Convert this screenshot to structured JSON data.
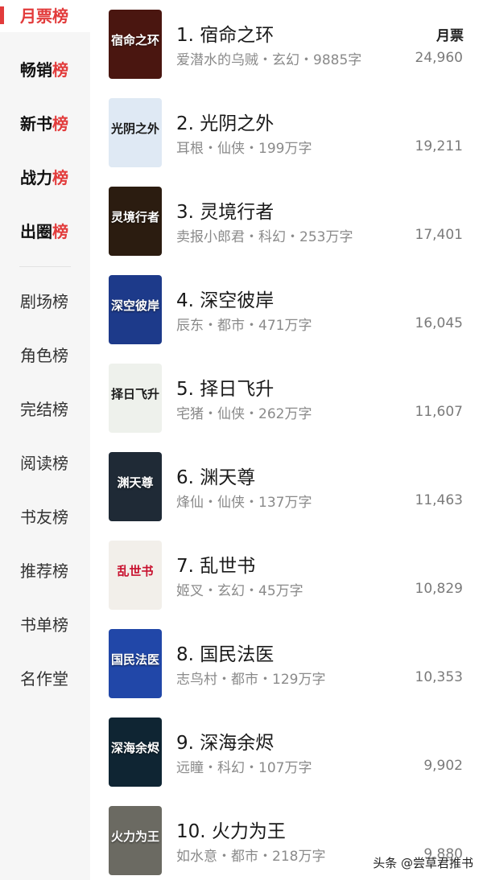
{
  "sidebar": {
    "items": [
      {
        "pre": "月票",
        "post": "榜",
        "style": "active"
      },
      {
        "pre": "畅销",
        "post": "榜",
        "style": "bold"
      },
      {
        "pre": "新书",
        "post": "榜",
        "style": "bold"
      },
      {
        "pre": "战力",
        "post": "榜",
        "style": "bold"
      },
      {
        "pre": "出圈",
        "post": "榜",
        "style": "bold"
      },
      {
        "pre": "剧场榜",
        "post": "",
        "style": "plain"
      },
      {
        "pre": "角色榜",
        "post": "",
        "style": "plain"
      },
      {
        "pre": "完结榜",
        "post": "",
        "style": "plain"
      },
      {
        "pre": "阅读榜",
        "post": "",
        "style": "plain"
      },
      {
        "pre": "书友榜",
        "post": "",
        "style": "plain"
      },
      {
        "pre": "推荐榜",
        "post": "",
        "style": "plain"
      },
      {
        "pre": "书单榜",
        "post": "",
        "style": "plain"
      },
      {
        "pre": "名作堂",
        "post": "",
        "style": "plain"
      }
    ]
  },
  "list": {
    "column_header": "月票",
    "books": [
      {
        "title": "1. 宿命之环",
        "meta": "爱潜水的乌贼・玄幻・9885字",
        "votes": "24,960",
        "cover_text": "宿命之环",
        "cover_bg": "#4a1610",
        "cover_text_style": ""
      },
      {
        "title": "2. 光阴之外",
        "meta": "耳根・仙侠・199万字",
        "votes": "19,211",
        "cover_text": "光阴之外",
        "cover_bg": "#dfe9f4",
        "cover_text_style": "dark"
      },
      {
        "title": "3. 灵境行者",
        "meta": "卖报小郎君・科幻・253万字",
        "votes": "17,401",
        "cover_text": "灵境行者",
        "cover_bg": "#2b1c10",
        "cover_text_style": ""
      },
      {
        "title": "4. 深空彼岸",
        "meta": "辰东・都市・471万字",
        "votes": "16,045",
        "cover_text": "深空彼岸",
        "cover_bg": "#1d3a8a",
        "cover_text_style": ""
      },
      {
        "title": "5. 择日飞升",
        "meta": "宅猪・仙侠・262万字",
        "votes": "11,607",
        "cover_text": "择日飞升",
        "cover_bg": "#eef1ec",
        "cover_text_style": "dark"
      },
      {
        "title": "6. 渊天尊",
        "meta": "烽仙・仙侠・137万字",
        "votes": "11,463",
        "cover_text": "渊天尊",
        "cover_bg": "#1f2a36",
        "cover_text_style": ""
      },
      {
        "title": "7. 乱世书",
        "meta": "姬叉・玄幻・45万字",
        "votes": "10,829",
        "cover_text": "乱世书",
        "cover_bg": "#f2efea",
        "cover_text_style": "red"
      },
      {
        "title": "8. 国民法医",
        "meta": "志鸟村・都市・129万字",
        "votes": "10,353",
        "cover_text": "国民法医",
        "cover_bg": "#2147a8",
        "cover_text_style": ""
      },
      {
        "title": "9. 深海余烬",
        "meta": "远瞳・科幻・107万字",
        "votes": "9,902",
        "cover_text": "深海余烬",
        "cover_bg": "#0f2533",
        "cover_text_style": ""
      },
      {
        "title": "10. 火力为王",
        "meta": "如水意・都市・218万字",
        "votes": "9,880",
        "cover_text": "火力为王",
        "cover_bg": "#6b6a62",
        "cover_text_style": ""
      }
    ]
  },
  "watermark": "头条 @尝草君推书",
  "colors": {
    "accent": "#e23b3b",
    "sidebar_bg": "#f6f6f6",
    "meta_text": "#8a8a8a"
  }
}
